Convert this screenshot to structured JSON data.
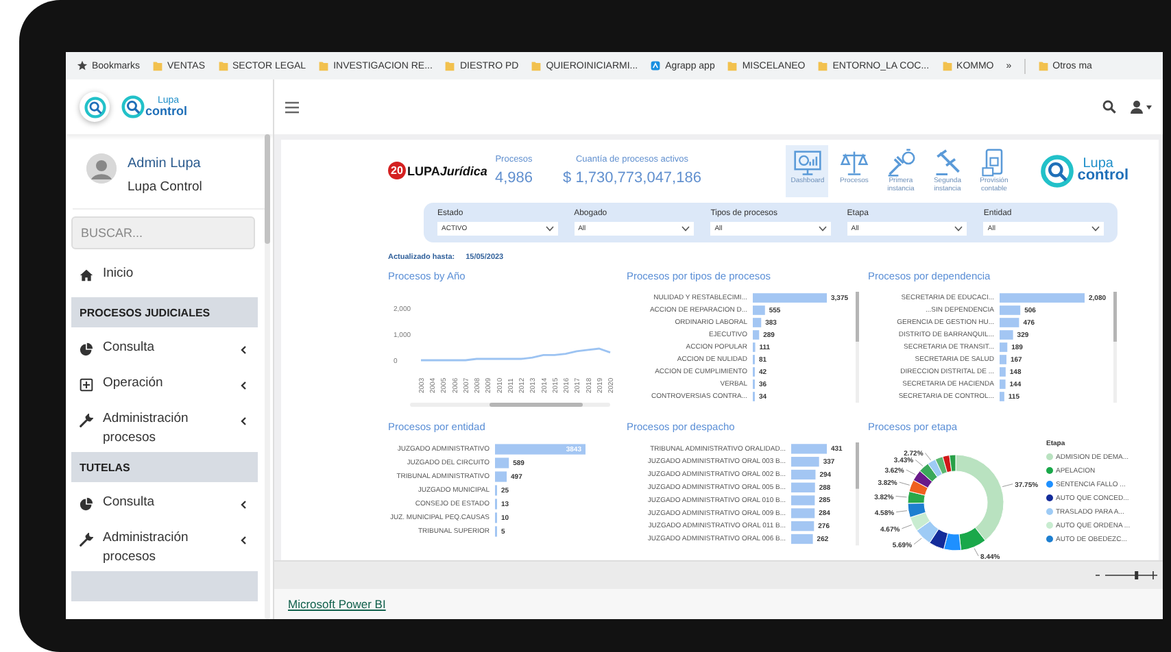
{
  "browser": {
    "bookmarks": [
      {
        "kind": "star",
        "label": "Bookmarks"
      },
      {
        "kind": "folder",
        "label": "VENTAS"
      },
      {
        "kind": "folder",
        "label": "SECTOR LEGAL"
      },
      {
        "kind": "folder",
        "label": "INVESTIGACION RE..."
      },
      {
        "kind": "folder",
        "label": "DIESTRO PD"
      },
      {
        "kind": "folder",
        "label": "QUIEROINICIARMI..."
      },
      {
        "kind": "app",
        "label": "Agrapp app"
      },
      {
        "kind": "folder",
        "label": "MISCELANEO"
      },
      {
        "kind": "folder",
        "label": "ENTORNO_LA COC..."
      },
      {
        "kind": "folder",
        "label": "KOMMO"
      },
      {
        "kind": "more",
        "label": "»"
      },
      {
        "kind": "folder",
        "label": "Otros ma"
      }
    ]
  },
  "sidebar": {
    "logo": {
      "line1": "Lupa",
      "line2": "control"
    },
    "user": {
      "name": "Admin Lupa",
      "role": "Lupa Control"
    },
    "search": {
      "placeholder": "BUSCAR..."
    },
    "menu": [
      {
        "kind": "home",
        "label": "Inicio",
        "expandable": false
      },
      {
        "kind": "header",
        "label": "PROCESOS JUDICIALES"
      },
      {
        "kind": "pie",
        "label": "Consulta",
        "expandable": true
      },
      {
        "kind": "plus-box",
        "label": "Operación",
        "expandable": true
      },
      {
        "kind": "wrench",
        "label": "Administración procesos",
        "expandable": true
      },
      {
        "kind": "header",
        "label": "TUTELAS"
      },
      {
        "kind": "pie",
        "label": "Consulta",
        "expandable": true
      },
      {
        "kind": "wrench",
        "label": "Administración procesos",
        "expandable": true
      },
      {
        "kind": "header"
      }
    ]
  },
  "report": {
    "brand": {
      "badge": "20",
      "name": "LUPA",
      "suffix": "Jurídica"
    },
    "kpis": [
      {
        "label": "Procesos",
        "value": "4,986"
      },
      {
        "label": "Cuantía de procesos activos",
        "value": "$ 1,730,773,047,186"
      }
    ],
    "nav": [
      {
        "kind": "dashboard",
        "label": "Dashboard",
        "selected": true
      },
      {
        "kind": "scale",
        "label": "Procesos",
        "selected": false
      },
      {
        "kind": "gavel-money",
        "label": "Primera instancia",
        "selected": false
      },
      {
        "kind": "gavel",
        "label": "Segunda instancia",
        "selected": false
      },
      {
        "kind": "phone-money",
        "label": "Provisión contable",
        "selected": false
      }
    ],
    "logo": {
      "line1": "Lupa",
      "line2": "control"
    },
    "filters": [
      {
        "label": "Estado",
        "value": "ACTIVO"
      },
      {
        "label": "Abogado",
        "value": "All"
      },
      {
        "label": "Tipos de procesos",
        "value": "All"
      },
      {
        "label": "Etapa",
        "value": "All"
      },
      {
        "label": "Entidad",
        "value": "All"
      }
    ],
    "updated": {
      "label": "Actualizado hasta:",
      "value": "15/05/2023"
    },
    "charts": [
      {
        "title": "Procesos by Año",
        "scrollbar": true,
        "chart_data": {
          "type": "line",
          "x": [
            "2003",
            "2004",
            "2005",
            "2006",
            "2007",
            "2008",
            "2009",
            "2010",
            "2011",
            "2012",
            "2013",
            "2014",
            "2015",
            "2016",
            "2017",
            "2018",
            "2019",
            "2020"
          ],
          "series": [
            {
              "color": "#9cc3f2",
              "values": [
                0,
                0,
                0,
                0,
                0,
                50,
                50,
                50,
                50,
                50,
                100,
                200,
                200,
                250,
                350,
                400,
                450,
                300
              ]
            }
          ],
          "ylim": [
            0,
            2000
          ],
          "yticks": [
            {
              "value": 0,
              "label": "0"
            },
            {
              "value": 1000,
              "label": "1,000"
            },
            {
              "value": 2000,
              "label": "2,000"
            }
          ]
        }
      },
      {
        "title": "Procesos por tipos de procesos",
        "scrollbar": true,
        "chart_data": {
          "type": "bar",
          "orientation": "horizontal",
          "data_labels": true,
          "categories": [
            "NULIDAD Y RESTABLECIMI...",
            "ACCION DE REPARACION D...",
            "ORDINARIO LABORAL",
            "EJECUTIVO",
            "ACCION POPULAR",
            "ACCION DE NULIDAD",
            "ACCION DE CUMPLIMIENTO",
            "VERBAL",
            "CONTROVERSIAS CONTRA..."
          ],
          "series": [
            {
              "color": "#a3c6f3",
              "values": [
                3375,
                555,
                383,
                289,
                111,
                81,
                42,
                36,
                34
              ],
              "value_labels": [
                "3,375",
                "555",
                "383",
                "289",
                "111",
                "81",
                "42",
                "36",
                "34"
              ]
            }
          ]
        }
      },
      {
        "title": "Procesos por dependencia",
        "scrollbar": true,
        "chart_data": {
          "type": "bar",
          "orientation": "horizontal",
          "data_labels": true,
          "categories": [
            "SECRETARIA DE EDUCACI...",
            "...SIN DEPENDENCIA",
            "GERENCIA DE GESTION HU...",
            "DISTRITO DE BARRANQUIL...",
            "SECRETARIA DE TRANSIT...",
            "SECRETARIA DE SALUD",
            "DIRECCION DISTRITAL DE ...",
            "SECRETARIA DE HACIENDA",
            "SECRETARIA DE CONTROL..."
          ],
          "series": [
            {
              "color": "#a3c6f3",
              "values": [
                2080,
                506,
                476,
                329,
                189,
                167,
                148,
                144,
                115
              ],
              "value_labels": [
                "2,080",
                "506",
                "476",
                "329",
                "189",
                "167",
                "148",
                "144",
                "115"
              ]
            }
          ]
        }
      },
      {
        "title": "Procesos por entidad",
        "scrollbar": false,
        "chart_data": {
          "type": "bar",
          "orientation": "horizontal",
          "data_labels": true,
          "categories": [
            "JUZGADO ADMINISTRATIVO",
            "JUZGADO DEL CIRCUITO",
            "TRIBUNAL ADMINISTRATIVO",
            "JUZGADO MUNICIPAL",
            "CONSEJO DE ESTADO",
            "JUZ. MUNICIPAL PEQ.CAUSAS",
            "TRIBUNAL SUPERIOR"
          ],
          "series": [
            {
              "color": "#a3c6f3",
              "values": [
                3843,
                589,
                497,
                25,
                13,
                10,
                5
              ]
            }
          ]
        }
      },
      {
        "title": "Procesos por despacho",
        "scrollbar": true,
        "chart_data": {
          "type": "bar",
          "orientation": "horizontal",
          "data_labels": true,
          "categories": [
            "TRIBUNAL ADMINISTRATIVO ORALIDAD...",
            "JUZGADO ADMINISTRATIVO ORAL 003 B...",
            "JUZGADO ADMINISTRATIVO ORAL 002 B...",
            "JUZGADO ADMINISTRATIVO ORAL 005 B...",
            "JUZGADO ADMINISTRATIVO ORAL 010 B...",
            "JUZGADO ADMINISTRATIVO ORAL 009 B...",
            "JUZGADO ADMINISTRATIVO ORAL 011 B...",
            "JUZGADO ADMINISTRATIVO ORAL 006 B..."
          ],
          "series": [
            {
              "color": "#a3c6f3",
              "values": [
                431,
                337,
                294,
                288,
                285,
                284,
                276,
                262
              ]
            }
          ]
        }
      },
      {
        "title": "Procesos por etapa",
        "scrollbar": false,
        "legend": {
          "title": "Etapa",
          "items": [
            {
              "label": "ADMISION DE DEMA...",
              "color": "#b9e2c0"
            },
            {
              "label": "APELACION",
              "color": "#1aa84a"
            },
            {
              "label": "SENTENCIA FALLO ...",
              "color": "#1e90ff"
            },
            {
              "label": "AUTO QUE CONCED...",
              "color": "#142c9a"
            },
            {
              "label": "TRASLADO PARA A...",
              "color": "#9ecbf5"
            },
            {
              "label": "AUTO QUE ORDENA ...",
              "color": "#c8ecd0"
            },
            {
              "label": "AUTO DE OBEDEZC...",
              "color": "#1e7fd0"
            }
          ]
        },
        "chart_data": {
          "type": "donut",
          "values": [
            37.75,
            8.44,
            5.5,
            4.95,
            5.69,
            4.67,
            4.58,
            3.82,
            3.82,
            3.62,
            3.43,
            2.72,
            2.5,
            2.2,
            2.0
          ],
          "colors": [
            "#b9e2c0",
            "#1aa84a",
            "#1e90ff",
            "#142c9a",
            "#9ecbf5",
            "#c8ecd0",
            "#1e7fd0",
            "#2aa84a",
            "#f06020",
            "#6a1a8a",
            "#3aa85a",
            "#9ecbf5",
            "#5ab870",
            "#d01818",
            "#28a048"
          ],
          "value_labels": [
            "37.75%",
            "8.44%",
            null,
            null,
            "5.69%",
            "4.67%",
            "4.58%",
            "3.82%",
            "3.82%",
            "3.62%",
            "3.43%",
            "2.72%",
            null,
            null,
            null
          ]
        }
      }
    ]
  },
  "zoom": {
    "level": 0.72
  },
  "footer": {
    "link": "Microsoft Power BI"
  }
}
